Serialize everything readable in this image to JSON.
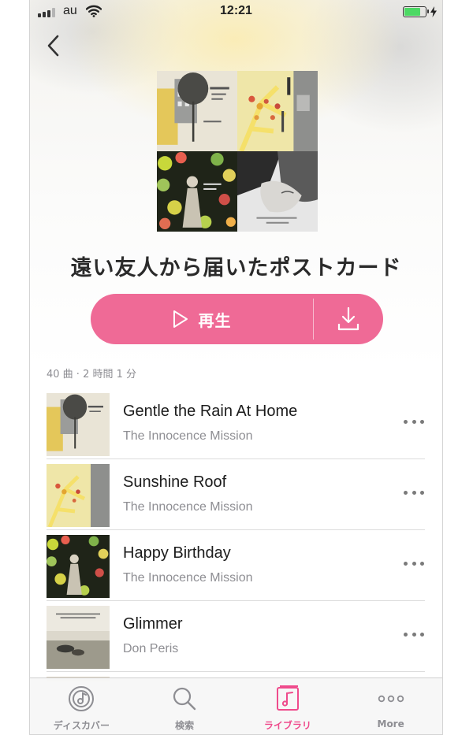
{
  "status_bar": {
    "carrier": "au",
    "time": "12:21",
    "battery_level": 0.75
  },
  "playlist": {
    "title": "遠い友人から届いたポストカード",
    "play_label": "再生",
    "meta": "40 曲 · 2 時間 1 分"
  },
  "tracks": [
    {
      "title": "Gentle the Rain At Home",
      "artist": "The Innocence Mission"
    },
    {
      "title": "Sunshine Roof",
      "artist": "The Innocence Mission"
    },
    {
      "title": "Happy Birthday",
      "artist": "The Innocence Mission"
    },
    {
      "title": "Glimmer",
      "artist": "Don Peris"
    }
  ],
  "tab_bar": {
    "tabs": [
      {
        "label": "ディスカバー",
        "icon": "discover-icon"
      },
      {
        "label": "検索",
        "icon": "search-icon"
      },
      {
        "label": "ライブラリ",
        "icon": "library-icon",
        "active": true
      },
      {
        "label": "More",
        "icon": "more-icon"
      }
    ]
  },
  "colors": {
    "accent": "#ef6a96",
    "active_tab": "#ef4b8c",
    "battery": "#4cd964",
    "secondary_text": "#8e8e93"
  }
}
